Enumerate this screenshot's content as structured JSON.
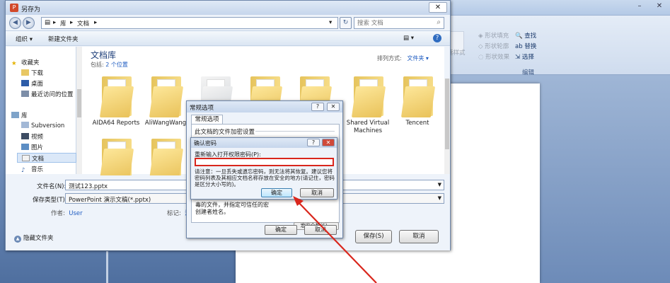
{
  "save_dialog": {
    "title": "另存为",
    "breadcrumb": [
      "库",
      "文档"
    ],
    "search_placeholder": "搜索 文档",
    "toolbar": {
      "organize": "组织 ▾",
      "new_folder": "新建文件夹"
    },
    "nav_items": [
      {
        "label": "收藏夹",
        "icon": "star-icon"
      },
      {
        "label": "下载",
        "icon": "download-folder-icon"
      },
      {
        "label": "桌面",
        "icon": "desktop-icon"
      },
      {
        "label": "最近访问的位置",
        "icon": "recent-places-icon"
      },
      {
        "label": "库",
        "icon": "libraries-icon"
      },
      {
        "label": "Subversion",
        "icon": "subversion-icon"
      },
      {
        "label": "视频",
        "icon": "video-icon"
      },
      {
        "label": "图片",
        "icon": "pictures-icon"
      },
      {
        "label": "文档",
        "icon": "documents-icon"
      },
      {
        "label": "音乐",
        "icon": "music-icon"
      }
    ],
    "library_title": "文档库",
    "library_includes": "包括:",
    "library_locations": "2 个位置",
    "arrange_label": "排列方式:",
    "arrange_value": "文件夹 ▾",
    "folders": [
      {
        "label": "AIDA64 Reports"
      },
      {
        "label": "AliWangWang"
      },
      {
        "label": ""
      },
      {
        "label": ""
      },
      {
        "label": ""
      },
      {
        "label": "Shared Virtual Machines"
      },
      {
        "label": "Tencent"
      }
    ],
    "filename_label": "文件名(N):",
    "filename_value": "测试123.pptx",
    "filetype_label": "保存类型(T):",
    "filetype_value": "PowerPoint 演示文稿(*.pptx)",
    "author_label": "作者:",
    "author_value": "User",
    "tags_label": "标记:",
    "tags_value": "添",
    "save_button": "保存(S)",
    "cancel_button": "取消",
    "hide_folders": "隐藏文件夹"
  },
  "general_options": {
    "title": "常规选项",
    "tab": "常规选项",
    "section": "此文档的文件加密设置",
    "hint": "毒的文件，并指定可信任的宏创建者姓名。",
    "small_button": "宏安全性(S)...",
    "ok_button": "确定",
    "cancel_button": "取消"
  },
  "confirm_password": {
    "title": "确认密码",
    "label": "重新输入打开权限密码(P):",
    "note": "请注意：一旦丢失或遗忘密码，则无法将其恢复。建议您将密码列表及其相应文档名称存放在安全的地方(请记住，密码是区分大小写的)。",
    "ok_button": "确定",
    "cancel_button": "取消"
  },
  "word_ribbon": {
    "shape_fill": "形状填充",
    "shape_outline": "形状轮廓",
    "shape_effects": "形状效果",
    "quick_styles": "速样式",
    "find": "查找",
    "replace": "替换",
    "select": "选择",
    "group_editing": "编辑"
  },
  "colors": {
    "accent": "#1f5cc1",
    "highlight_red": "#d9261c",
    "folder_yellow": "#f2d06b"
  }
}
